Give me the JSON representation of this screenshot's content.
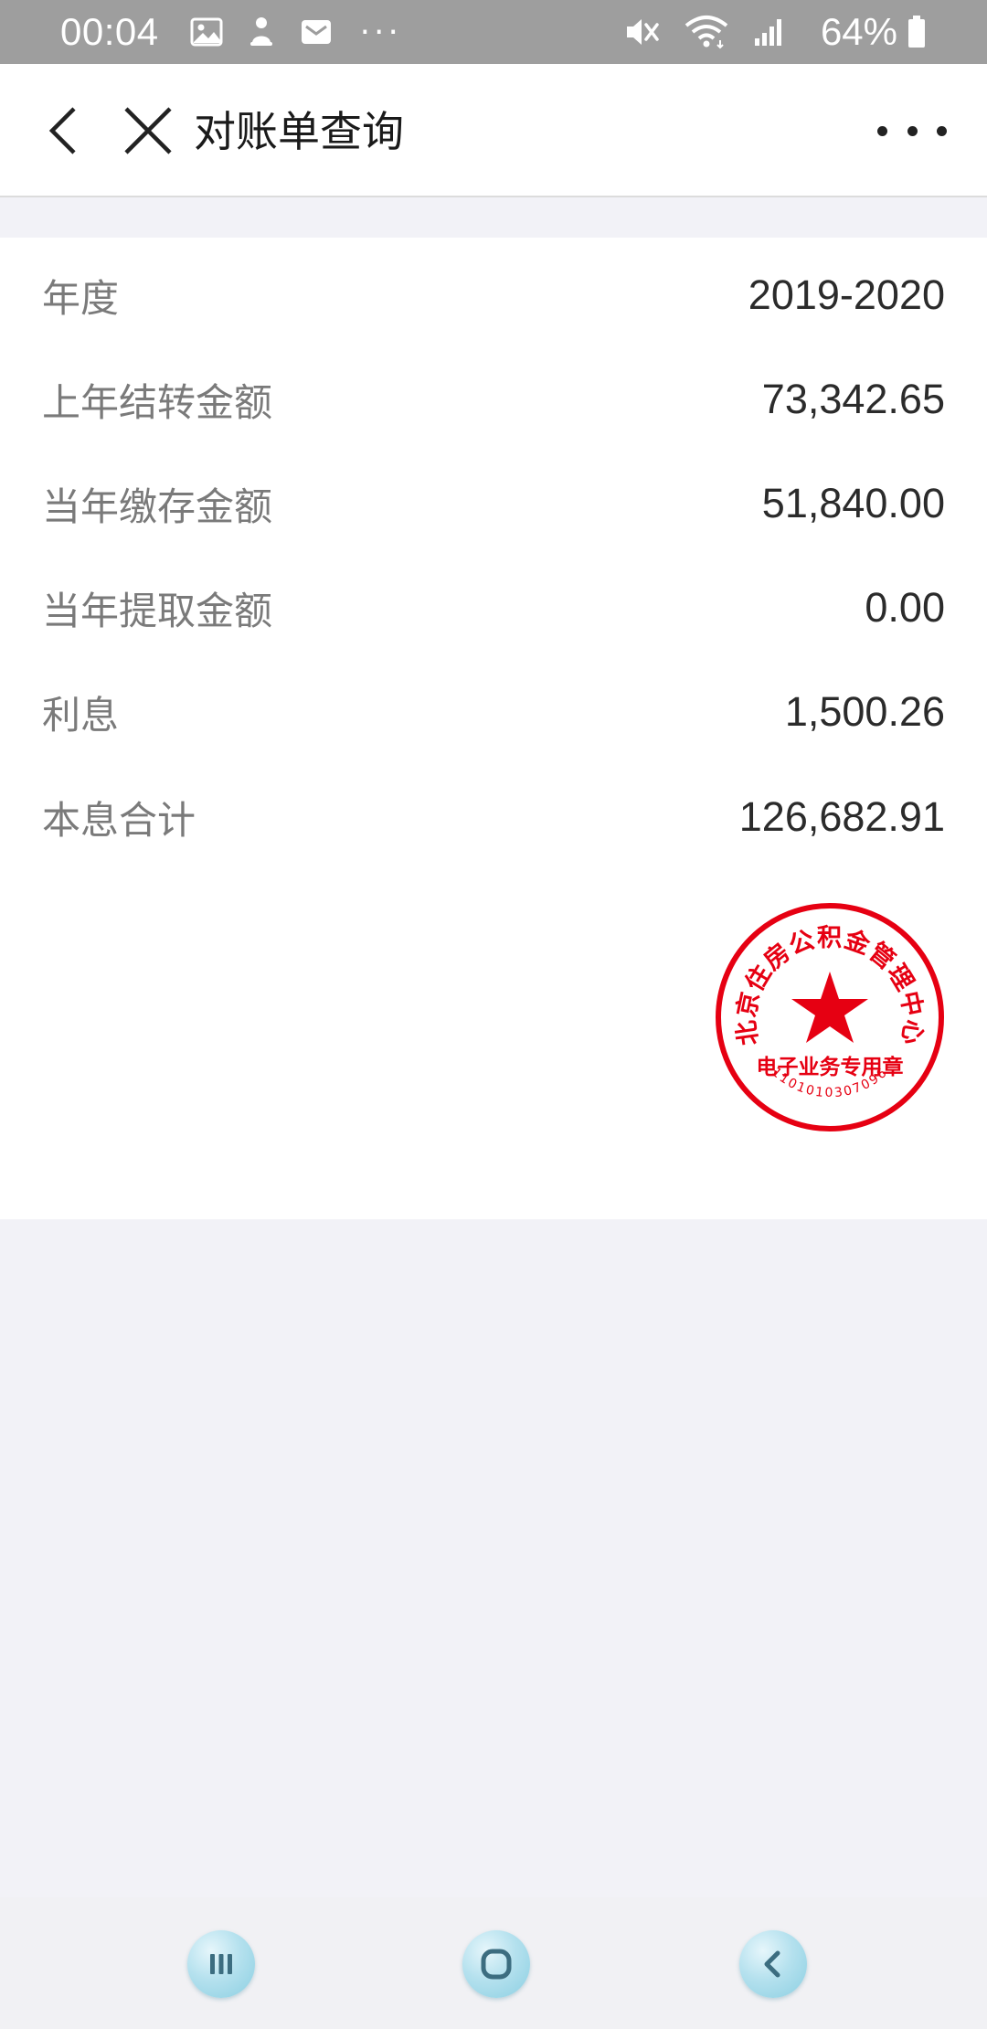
{
  "status_bar": {
    "time": "00:04",
    "battery": "64%",
    "more": "···",
    "icons": [
      "image-icon",
      "app-notification-icon",
      "mail-icon",
      "mute-icon",
      "wifi-icon",
      "signal-icon",
      "battery-icon"
    ]
  },
  "header": {
    "title": "对账单查询",
    "back_icon": "back-arrow-icon",
    "close_icon": "close-icon",
    "more_icon": "more-icon"
  },
  "statement": {
    "rows": [
      {
        "label": "年度",
        "value": "2019-2020"
      },
      {
        "label": "上年结转金额",
        "value": "73,342.65"
      },
      {
        "label": "当年缴存金额",
        "value": "51,840.00"
      },
      {
        "label": "当年提取金额",
        "value": "0.00"
      },
      {
        "label": "利息",
        "value": "1,500.26"
      },
      {
        "label": "本息合计",
        "value": "126,682.91"
      }
    ]
  },
  "seal": {
    "outer_text": "北京住房公积金管理中心",
    "inner_text": "电子业务专用章",
    "number": "1101010307096",
    "color": "#e60012"
  },
  "nav_bar": {
    "buttons": [
      "recent-apps-icon",
      "home-icon",
      "back-icon"
    ]
  }
}
